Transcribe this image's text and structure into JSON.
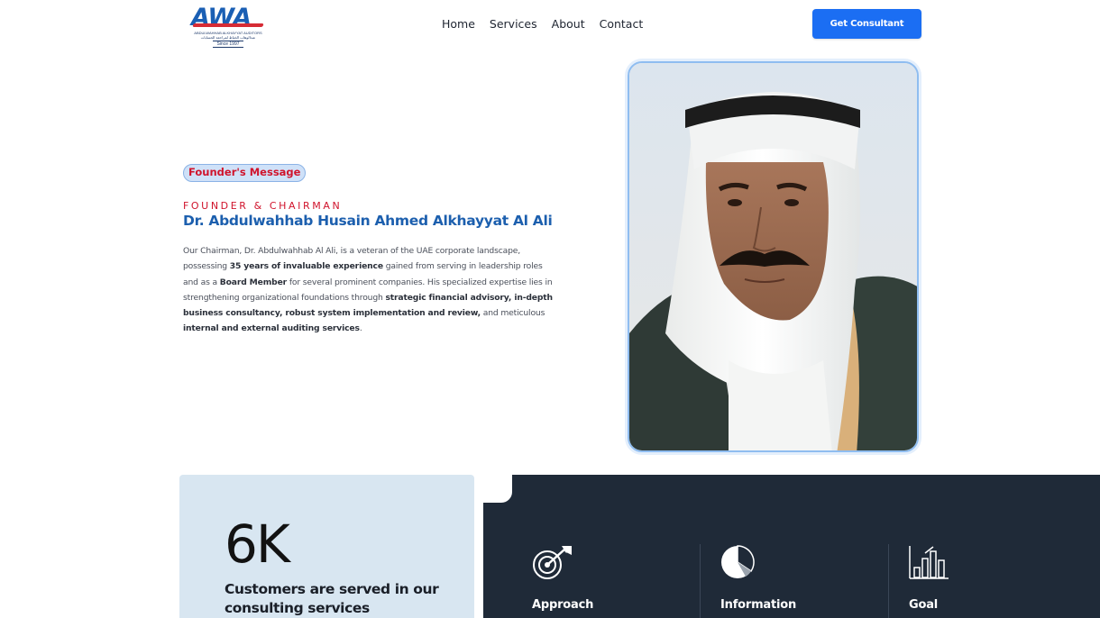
{
  "header": {
    "logo": {
      "mark": "AWA",
      "subtitle": "ABDULWAHHAB ALKHAYYAT AUDITORS",
      "subtitle_ar": "عبدالوهاب الخياط لمراجعة الحسابات",
      "since": "Since 1997"
    },
    "nav": [
      "Home",
      "Services",
      "About",
      "Contact"
    ],
    "cta_label": "Get Consultant"
  },
  "founder": {
    "badge": "Founder's Message",
    "role": "FOUNDER & CHAIRMAN",
    "name": "Dr. Abdulwahhab Husain Ahmed Alkhayyat Al Ali",
    "bio": [
      {
        "t": "Our Chairman, Dr. Abdulwahhab Al Ali, is a veteran of the UAE corporate landscape, possessing ",
        "b": false
      },
      {
        "t": "35 years of invaluable experience",
        "b": true
      },
      {
        "t": " gained from serving in leadership roles and as a ",
        "b": false
      },
      {
        "t": "Board Member",
        "b": true
      },
      {
        "t": " for several prominent companies. His specialized expertise lies in strengthening organizational foundations through ",
        "b": false
      },
      {
        "t": "strategic financial advisory, in-depth business consultancy, robust system implementation and review,",
        "b": true
      },
      {
        "t": " and meticulous ",
        "b": false
      },
      {
        "t": "internal and external auditing services",
        "b": true
      },
      {
        "t": ".",
        "b": false
      }
    ]
  },
  "stats": {
    "value": "6K",
    "text": "Customers are served in our consulting services"
  },
  "features": [
    {
      "label": "Approach",
      "icon": "target-arrow-icon"
    },
    {
      "label": "Information",
      "icon": "pie-chart-icon"
    },
    {
      "label": "Goal",
      "icon": "bar-chart-icon"
    }
  ],
  "colors": {
    "primary_blue": "#1b6ef3",
    "name_blue": "#1c5fae",
    "accent_red": "#d0142c",
    "dark_panel": "#1f2a38",
    "stats_bg": "#d8e6f1"
  }
}
